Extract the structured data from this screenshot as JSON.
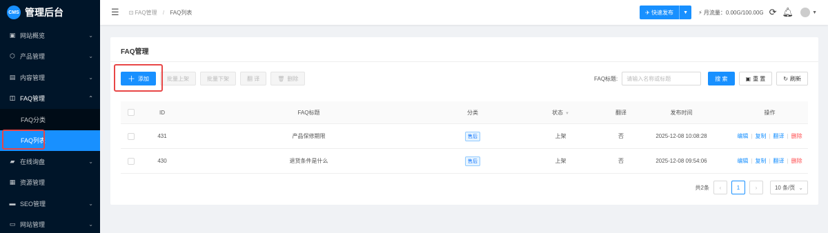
{
  "app": {
    "logo_badge": "CMS",
    "title": "管理后台"
  },
  "sidebar": {
    "items": [
      {
        "label": "网站概览",
        "icon": "monitor-icon"
      },
      {
        "label": "产品管理",
        "icon": "cube-icon"
      },
      {
        "label": "内容管理",
        "icon": "document-icon"
      },
      {
        "label": "FAQ管理",
        "icon": "faq-icon"
      },
      {
        "label": "在线询盘",
        "icon": "chat-icon"
      },
      {
        "label": "资源管理",
        "icon": "folder-icon"
      },
      {
        "label": "SEO管理",
        "icon": "seo-icon"
      },
      {
        "label": "网站管理",
        "icon": "window-icon"
      }
    ],
    "sub_items": [
      {
        "label": "FAQ分类"
      },
      {
        "label": "FAQ列表"
      }
    ]
  },
  "header": {
    "breadcrumb": [
      "FAQ管理",
      "FAQ列表"
    ],
    "publish_label": "快速发布",
    "traffic_label": "月流量：0.00G/100.00G"
  },
  "card": {
    "title": "FAQ管理"
  },
  "toolbar": {
    "add_label": "添加",
    "batch_on_label": "批量上架",
    "batch_off_label": "批量下架",
    "translate_label": "翻 译",
    "delete_label": "删除"
  },
  "search": {
    "label": "FAQ标题:",
    "placeholder": "请输入名称或标题",
    "search_label": "搜 索",
    "reset_label": "重 置",
    "refresh_label": "刷新"
  },
  "table": {
    "headers": {
      "id": "ID",
      "title": "FAQ标题",
      "category": "分类",
      "status": "状态",
      "translate": "翻译",
      "time": "发布时间",
      "ops": "操作"
    },
    "rows": [
      {
        "id": "431",
        "title": "产品保修期限",
        "category": "售后",
        "status": "上架",
        "translate": "否",
        "time": "2025-12-08 10:08:28"
      },
      {
        "id": "430",
        "title": "退货条件是什么",
        "category": "售后",
        "status": "上架",
        "translate": "否",
        "time": "2025-12-08 09:54:06"
      }
    ],
    "ops": {
      "edit": "编辑",
      "copy": "复制",
      "translate": "翻译",
      "delete": "删除"
    }
  },
  "pagination": {
    "total": "共2条",
    "current": "1",
    "page_size": "10 条/页"
  }
}
